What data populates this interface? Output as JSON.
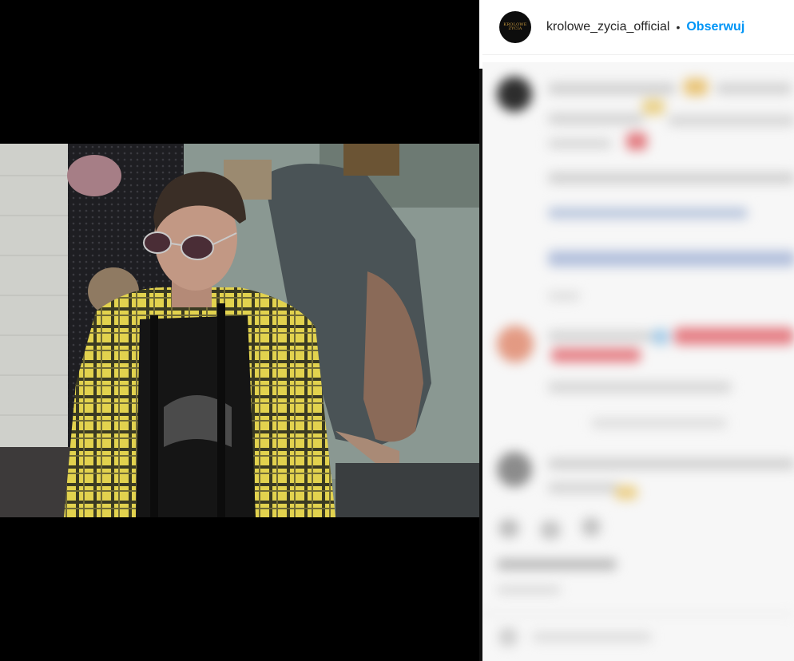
{
  "post_header": {
    "avatar_text_line1": "KROLOWE",
    "avatar_text_line2": "ZYCIA",
    "username": "krolowe_zycia_official",
    "separator": "•",
    "follow_label": "Obserwuj"
  },
  "video": {
    "muted": true,
    "mute_icon": "speaker-muted-icon"
  },
  "comments": {
    "blurred": true
  },
  "colors": {
    "follow_blue": "#0095f6",
    "text_dark": "#262626",
    "media_background": "#000000",
    "shirt_yellow": "#e6d24a"
  }
}
